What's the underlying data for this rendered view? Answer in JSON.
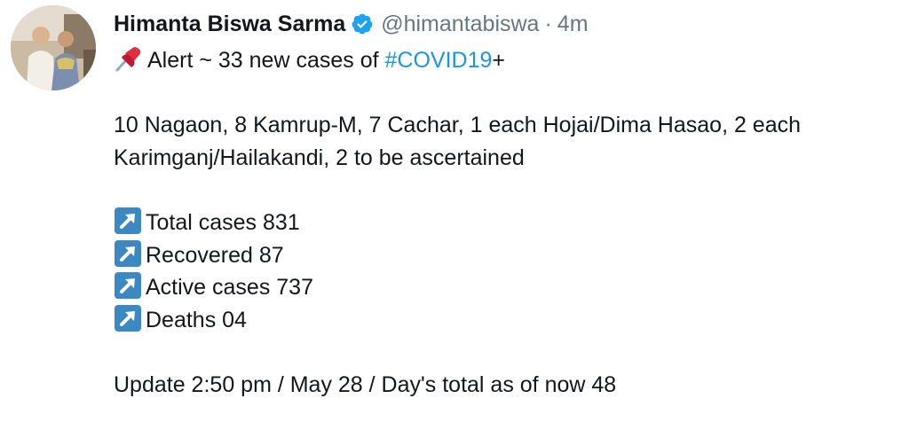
{
  "author": {
    "display_name": "Himanta Biswa Sarma",
    "handle": "@himantabiswa",
    "separator": "·",
    "timestamp": "4m",
    "verified_icon": "verified-badge-icon",
    "avatar_icon": "profile-photo"
  },
  "tweet": {
    "line1_prefix": "Alert ~  33 new cases of ",
    "hashtag": "#COVID19",
    "line1_suffix": "+",
    "pin_icon": "pushpin-icon",
    "breakdown_line1": "10 Nagaon, 8 Kamrup-M, 7 Cachar, 1 each Hojai/Dima Hasao, 2 each",
    "breakdown_line2": "Karimganj/Hailakandi, 2 to be ascertained",
    "stats": [
      {
        "label": "Total cases 831",
        "icon": "up-right-arrow-icon"
      },
      {
        "label": "Recovered 87",
        "icon": "up-right-arrow-icon"
      },
      {
        "label": "Active cases 737",
        "icon": "up-right-arrow-icon"
      },
      {
        "label": "Deaths 04",
        "icon": "up-right-arrow-icon"
      }
    ],
    "update_line": "Update 2:50 pm / May 28 / Day's total as of now 48"
  },
  "colors": {
    "hashtag": "#1b95e0",
    "verified": "#1da1f2",
    "secondary_text": "#657786",
    "arrow_emoji_bg": "#3b88c3"
  }
}
